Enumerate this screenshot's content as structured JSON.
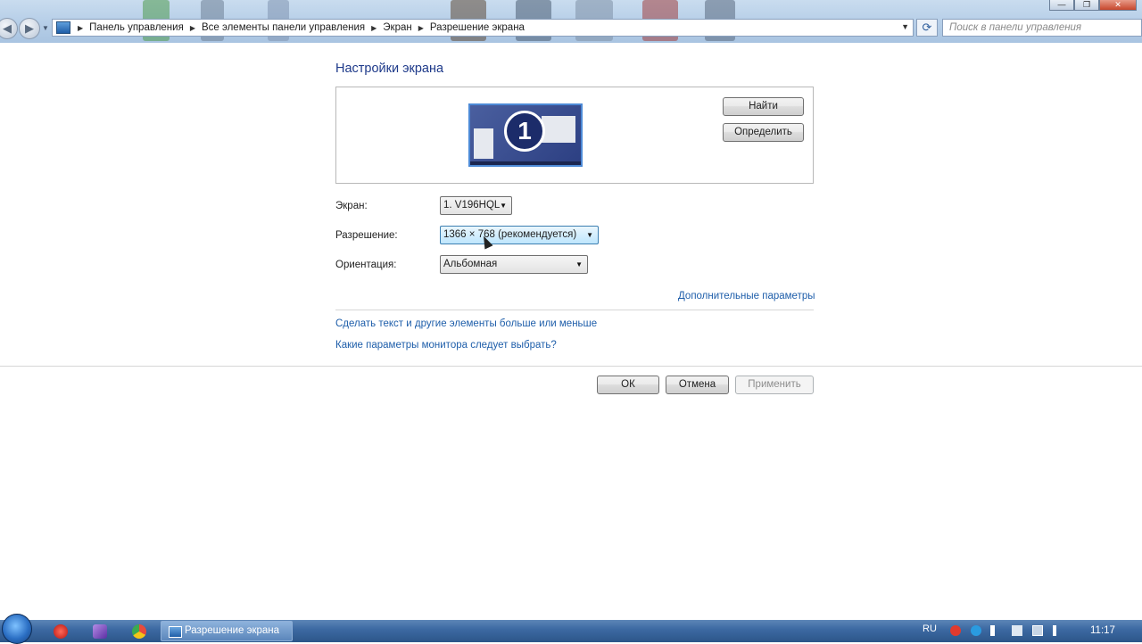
{
  "window": {
    "minimize_glyph": "—",
    "maximize_glyph": "❐",
    "close_glyph": "✕"
  },
  "nav": {
    "back_glyph": "◀",
    "forward_glyph": "▶",
    "refresh_glyph": "⟳"
  },
  "breadcrumb": [
    "Панель управления",
    "Все элементы панели управления",
    "Экран",
    "Разрешение экрана"
  ],
  "search": {
    "placeholder": "Поиск в панели управления"
  },
  "page": {
    "title": "Настройки экрана",
    "monitor_number": "1",
    "find_button": "Найти",
    "identify_button": "Определить",
    "display_label": "Экран:",
    "display_value": "1. V196HQL",
    "resolution_label": "Разрешение:",
    "resolution_value": "1366 × 768 (рекомендуется)",
    "orientation_label": "Ориентация:",
    "orientation_value": "Альбомная",
    "advanced_link": "Дополнительные параметры",
    "text_size_link": "Сделать текст и другие элементы больше или меньше",
    "monitor_help_link": "Какие параметры монитора следует выбрать?",
    "ok_button": "ОК",
    "cancel_button": "Отмена",
    "apply_button": "Применить"
  },
  "taskbar": {
    "active_task": "Разрешение экрана",
    "language": "RU",
    "clock": "11:17"
  },
  "colors": {
    "title_blue": "#1e3a8a",
    "link_blue": "#1e5eaa",
    "taskbar": "#3d6aa3"
  }
}
